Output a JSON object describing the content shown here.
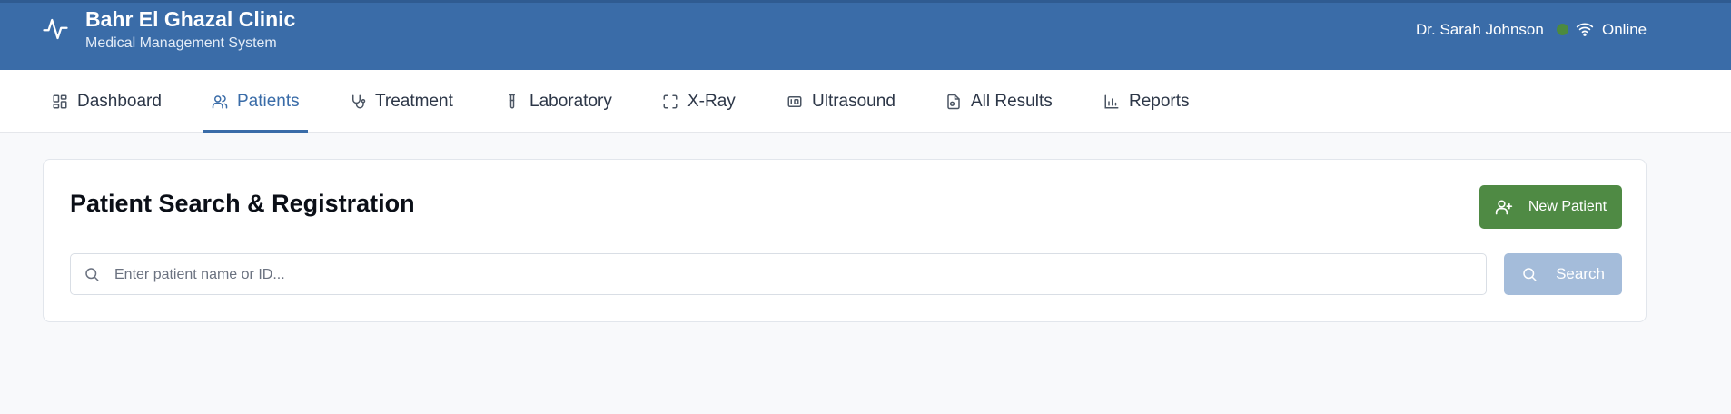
{
  "header": {
    "title": "Bahr El Ghazal Clinic",
    "subtitle": "Medical Management System",
    "user": "Dr. Sarah Johnson",
    "status": "Online",
    "status_color": "#4c8a3f",
    "brand_color": "#3a6ca8"
  },
  "nav": {
    "tabs": [
      {
        "label": "Dashboard",
        "icon": "dashboard-icon",
        "active": false
      },
      {
        "label": "Patients",
        "icon": "users-icon",
        "active": true
      },
      {
        "label": "Treatment",
        "icon": "stethoscope-icon",
        "active": false
      },
      {
        "label": "Laboratory",
        "icon": "test-tube-icon",
        "active": false
      },
      {
        "label": "X-Ray",
        "icon": "scan-icon",
        "active": false
      },
      {
        "label": "Ultrasound",
        "icon": "ultrasound-icon",
        "active": false
      },
      {
        "label": "All Results",
        "icon": "file-results-icon",
        "active": false
      },
      {
        "label": "Reports",
        "icon": "bar-chart-icon",
        "active": false
      }
    ]
  },
  "main": {
    "title": "Patient Search & Registration",
    "new_patient_label": "New Patient",
    "search_placeholder": "Enter patient name or ID...",
    "search_value": "",
    "search_button_label": "Search",
    "new_button_color": "#4f8a44",
    "search_button_color": "#a4bcda"
  }
}
